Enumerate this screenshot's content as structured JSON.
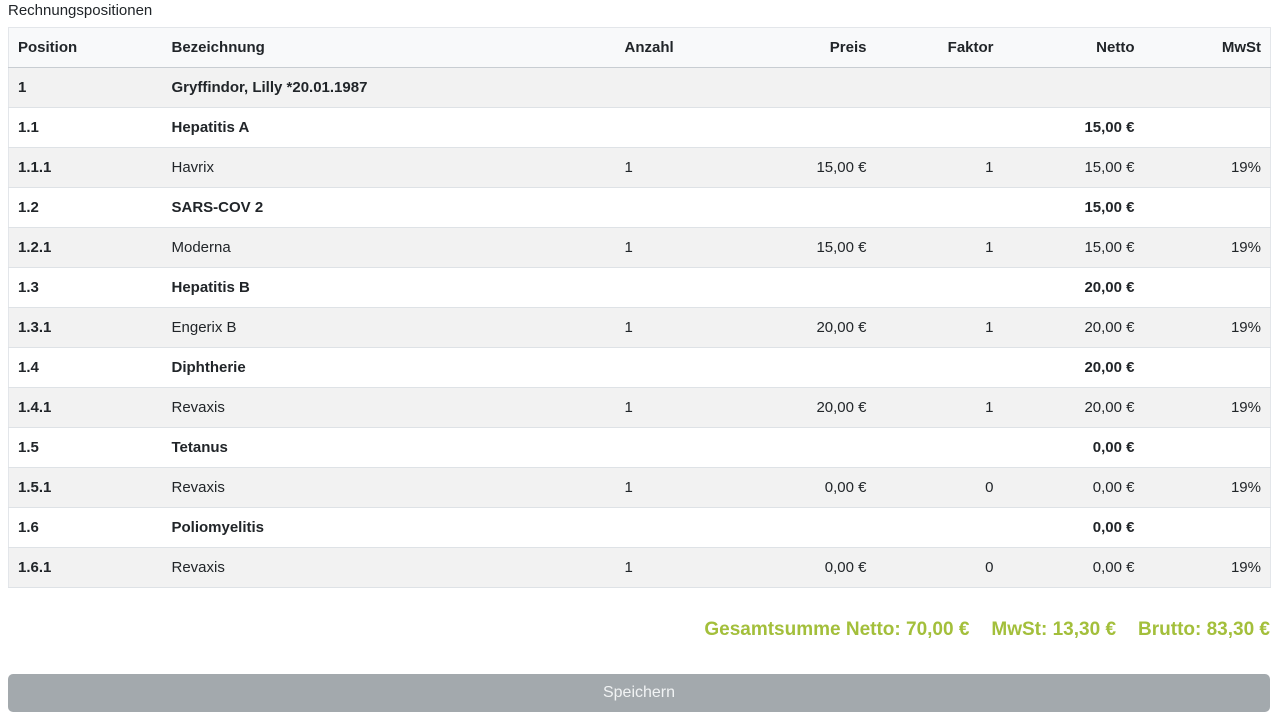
{
  "section_title": "Rechnungspositionen",
  "table": {
    "headers": {
      "position": "Position",
      "bezeichnung": "Bezeichnung",
      "anzahl": "Anzahl",
      "preis": "Preis",
      "faktor": "Faktor",
      "netto": "Netto",
      "mwst": "MwSt"
    },
    "rows": [
      {
        "kind": "group",
        "position": "1",
        "bezeichnung": "Gryffindor, Lilly *20.01.1987",
        "anzahl": "",
        "preis": "",
        "faktor": "",
        "netto": "",
        "mwst": ""
      },
      {
        "kind": "subgroup",
        "position": "1.1",
        "bezeichnung": "Hepatitis A",
        "anzahl": "",
        "preis": "",
        "faktor": "",
        "netto": "15,00 €",
        "mwst": ""
      },
      {
        "kind": "line",
        "position": "1.1.1",
        "bezeichnung": "Havrix",
        "anzahl": "1",
        "preis": "15,00 €",
        "faktor": "1",
        "netto": "15,00 €",
        "mwst": "19%"
      },
      {
        "kind": "subgroup",
        "position": "1.2",
        "bezeichnung": "SARS-COV 2",
        "anzahl": "",
        "preis": "",
        "faktor": "",
        "netto": "15,00 €",
        "mwst": ""
      },
      {
        "kind": "line",
        "position": "1.2.1",
        "bezeichnung": "Moderna",
        "anzahl": "1",
        "preis": "15,00 €",
        "faktor": "1",
        "netto": "15,00 €",
        "mwst": "19%"
      },
      {
        "kind": "subgroup",
        "position": "1.3",
        "bezeichnung": "Hepatitis B",
        "anzahl": "",
        "preis": "",
        "faktor": "",
        "netto": "20,00 €",
        "mwst": ""
      },
      {
        "kind": "line",
        "position": "1.3.1",
        "bezeichnung": "Engerix B",
        "anzahl": "1",
        "preis": "20,00 €",
        "faktor": "1",
        "netto": "20,00 €",
        "mwst": "19%"
      },
      {
        "kind": "subgroup",
        "position": "1.4",
        "bezeichnung": "Diphtherie",
        "anzahl": "",
        "preis": "",
        "faktor": "",
        "netto": "20,00 €",
        "mwst": ""
      },
      {
        "kind": "line",
        "position": "1.4.1",
        "bezeichnung": "Revaxis",
        "anzahl": "1",
        "preis": "20,00 €",
        "faktor": "1",
        "netto": "20,00 €",
        "mwst": "19%"
      },
      {
        "kind": "subgroup",
        "position": "1.5",
        "bezeichnung": "Tetanus",
        "anzahl": "",
        "preis": "",
        "faktor": "",
        "netto": "0,00 €",
        "mwst": ""
      },
      {
        "kind": "line",
        "position": "1.5.1",
        "bezeichnung": "Revaxis",
        "anzahl": "1",
        "preis": "0,00 €",
        "faktor": "0",
        "netto": "0,00 €",
        "mwst": "19%"
      },
      {
        "kind": "subgroup",
        "position": "1.6",
        "bezeichnung": "Poliomyelitis",
        "anzahl": "",
        "preis": "",
        "faktor": "",
        "netto": "0,00 €",
        "mwst": ""
      },
      {
        "kind": "line",
        "position": "1.6.1",
        "bezeichnung": "Revaxis",
        "anzahl": "1",
        "preis": "0,00 €",
        "faktor": "0",
        "netto": "0,00 €",
        "mwst": "19%"
      }
    ]
  },
  "totals": {
    "netto": "Gesamtsumme Netto: 70,00 €",
    "mwst": "MwSt: 13,30 €",
    "brutto": "Brutto: 83,30 €"
  },
  "save_button": {
    "label": "Speichern"
  },
  "colors": {
    "totals_accent": "#a3bf3b",
    "button_disabled": "#a3a9ad"
  }
}
